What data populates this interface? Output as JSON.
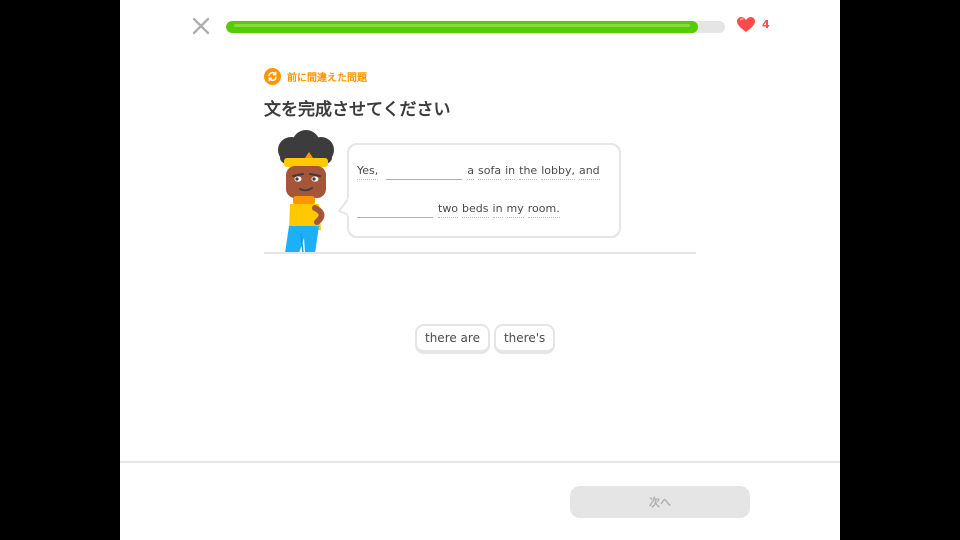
{
  "header": {
    "progress_fraction": 0.945,
    "hearts_count": "4",
    "colors": {
      "progress": "#58cc02",
      "heart": "#ff4b4b"
    }
  },
  "exercise": {
    "badge_label": "前に間違えた問題",
    "title": "文を完成させてください",
    "line1_before": [
      "Yes,"
    ],
    "line1_after": [
      "a",
      "sofa",
      "in",
      "the",
      "lobby,",
      "and"
    ],
    "line2_after": [
      "two",
      "beds",
      "in",
      "my",
      "room."
    ]
  },
  "word_bank": [
    "there are",
    "there's"
  ],
  "footer": {
    "next_label": "次へ"
  },
  "icons": {
    "close": "close-icon",
    "heart": "heart-icon",
    "badge": "retry-icon"
  }
}
